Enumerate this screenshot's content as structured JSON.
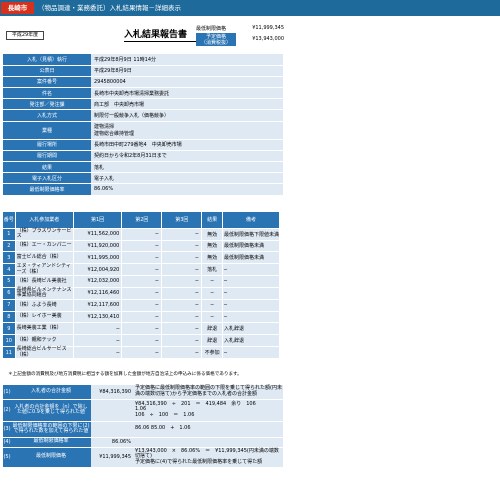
{
  "header": {
    "brand": "長崎市",
    "title": "（物品調達・業務委託）入札結果情報－詳細表示"
  },
  "year_badge": "平成29年度",
  "report_title": "入札結果報告書",
  "summary": {
    "min_limit_label": "最低制限価格",
    "min_limit_value": "¥11,999,345",
    "contract_label_line1": "予定価格",
    "contract_label_line2": "（消費税抜）",
    "contract_value": "¥13,943,000"
  },
  "info": [
    {
      "k": "入札（見積）執行",
      "v": "平成29年8月9日 11時14分"
    },
    {
      "k": "公表日",
      "v": "平成29年8月9日"
    },
    {
      "k": "案件番号",
      "v": "2945800004"
    },
    {
      "k": "件名",
      "v": "長崎市中央卸売市場清掃業務委託"
    },
    {
      "k": "発注部／発注課",
      "v": "商工部　中央卸売市場"
    },
    {
      "k": "入札方式",
      "v": "制限付一般競争入札（価格競争）"
    },
    {
      "k": "業種",
      "v": "建物清掃",
      "v2": "建物総合維持管理"
    },
    {
      "k": "履行場所",
      "v": "長崎市田中町279番地4　中央卸売市場"
    },
    {
      "k": "履行期間",
      "v": "契約日から令和2年8月31日まで"
    },
    {
      "k": "結果",
      "v": "落札"
    },
    {
      "k": "電子入札区分",
      "v": "電子入札"
    },
    {
      "k": "最低制限価格率",
      "v": "86.06%"
    }
  ],
  "bids": {
    "headers": [
      "番号",
      "入札参加業者",
      "第1回",
      "第2回",
      "第3回",
      "結果",
      "備考"
    ],
    "rows": [
      {
        "no": "1",
        "name": "（株）プラスワンサービス",
        "r1": "¥11,562,000",
        "r2": "─",
        "r3": "─",
        "res": "無効",
        "rem": "最低制限価格下限値未満"
      },
      {
        "no": "2",
        "name": "（株）エー・カンパニー",
        "r1": "¥11,920,000",
        "r2": "─",
        "r3": "─",
        "res": "無効",
        "rem": "最低制限価格未満"
      },
      {
        "no": "3",
        "name": "富士ビル総合（株）",
        "r1": "¥11,995,000",
        "r2": "─",
        "r3": "─",
        "res": "無効",
        "rem": "最低制限価格未満"
      },
      {
        "no": "4",
        "name": "エヌ・ティアンドシティーズ（株）",
        "r1": "¥12,004,920",
        "r2": "─",
        "r3": "─",
        "res": "落札",
        "rem": "─"
      },
      {
        "no": "5",
        "name": "（株）長崎ビル美装社",
        "r1": "¥12,032,000",
        "r2": "─",
        "r3": "─",
        "res": "─",
        "rem": "─"
      },
      {
        "no": "6",
        "name": "長崎県ビルメンテナンス事業協同組合",
        "r1": "¥12,116,460",
        "r2": "─",
        "r3": "─",
        "res": "─",
        "rem": "─"
      },
      {
        "no": "7",
        "name": "（株）ふよう長崎",
        "r1": "¥12,117,600",
        "r2": "─",
        "r3": "─",
        "res": "─",
        "rem": "─"
      },
      {
        "no": "8",
        "name": "（株）レイホー美装",
        "r1": "¥12,130,410",
        "r2": "─",
        "r3": "─",
        "res": "─",
        "rem": "─"
      },
      {
        "no": "9",
        "name": "長崎美装工業（株）",
        "r1": "─",
        "r2": "─",
        "r3": "─",
        "res": "辞退",
        "rem": "入札辞退"
      },
      {
        "no": "10",
        "name": "（株）親和テック",
        "r1": "─",
        "r2": "─",
        "r3": "─",
        "res": "辞退",
        "rem": "入札辞退"
      },
      {
        "no": "11",
        "name": "長崎総合ビルサービス（株）",
        "r1": "─",
        "r2": "─",
        "r3": "─",
        "res": "不参加",
        "rem": "─"
      }
    ]
  },
  "note": "＊上記金額の消費税及び地方消費税に相当する額を加算した金額が地方自治法上の申込みに係る価格であります。",
  "calc": [
    {
      "no": "(1)",
      "k": "入札者の合計金額",
      "v": "¥84,316,390",
      "d": "予定価格に最低制限価格率の範囲の下限を乗じて得られた額(円未満の端数切捨て)から予定価格までの入札者の合計金額"
    },
    {
      "no": "(2)",
      "k": "入札者の合計金額を（n）で除した値に0.9を乗じて得られた値",
      "v": "",
      "d": "¥84,316,390　÷　201　＝　419,484　余り　106",
      "d2": "1.06",
      "d3": "106　÷　100　＝　1.06"
    },
    {
      "no": "(3)",
      "k": "最低制限価格率の範囲の下限に(2)で得られた数を加えて得られた値",
      "v": "",
      "d": "86.06 85.00　+　1.06"
    },
    {
      "no": "(4)",
      "k": "最低制限価格率",
      "v": "86.06%",
      "d": ""
    },
    {
      "no": "(5)",
      "k": "最低制限価格",
      "v": "¥11,999,345",
      "d": "¥13,943,000　×　86.06%　＝　¥11,999,345(円未満の端数切捨て)",
      "d2": "予定価格に(4)で得られた最低制限価格率を乗じて得た額"
    }
  ]
}
